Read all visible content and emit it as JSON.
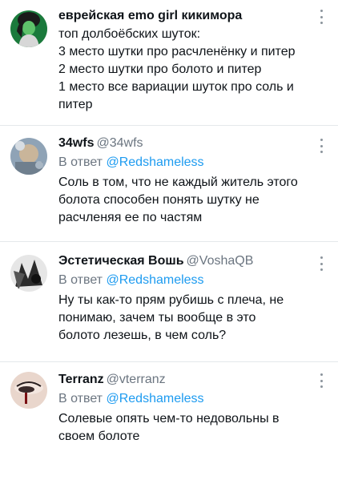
{
  "tweets": [
    {
      "name": "еврейская emo girl кикимора",
      "handle": "",
      "reply_prefix": "",
      "reply_mention": "",
      "lines": [
        "топ долбоёбских шуток:",
        "3 место шутки про расчленёнку и питер",
        "2 место шутки про болото и питер",
        "1 место все вариации шуток про соль и",
        "питер"
      ]
    },
    {
      "name": "34wfs",
      "handle": "@34wfs",
      "reply_prefix": "В ответ",
      "reply_mention": "@Redshameless",
      "lines": [
        "Соль в том, что не каждый житель этого",
        "болота способен понять шутку не",
        "расчленяя ее по частям"
      ]
    },
    {
      "name": "Эстетическая Вошь",
      "handle": "@VoshaQB",
      "reply_prefix": "В ответ",
      "reply_mention": "@Redshameless",
      "lines": [
        "Ну ты как-то прям рубишь с плеча, не",
        "понимаю, зачем ты вообще в это",
        "болото лезешь, в чем соль?"
      ]
    },
    {
      "name": "Terranz",
      "handle": "@vterranz",
      "reply_prefix": "В ответ",
      "reply_mention": "@Redshameless",
      "lines": [
        "Солевые опять чем-то недовольны в",
        "своем болоте"
      ]
    }
  ]
}
